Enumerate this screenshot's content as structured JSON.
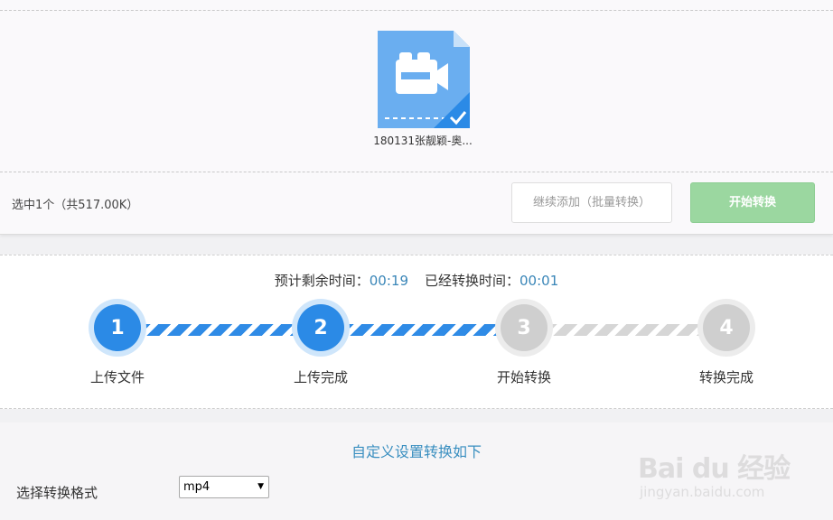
{
  "upload": {
    "file_name": "180131张靓颖-奥...",
    "selected_info": "选中1个（共517.00K）",
    "add_more_label": "继续添加（批量转换）",
    "start_label": "开始转换"
  },
  "progress": {
    "remaining_label": "预计剩余时间：",
    "remaining_value": "00:19",
    "elapsed_label": "已经转换时间：",
    "elapsed_value": "00:01",
    "steps": [
      {
        "number": "1",
        "label": "上传文件",
        "state": "done"
      },
      {
        "number": "2",
        "label": "上传完成",
        "state": "done"
      },
      {
        "number": "3",
        "label": "开始转换",
        "state": "pending"
      },
      {
        "number": "4",
        "label": "转换完成",
        "state": "pending"
      }
    ]
  },
  "settings": {
    "title": "自定义设置转换如下",
    "format_label": "选择转换格式",
    "format_value": "mp4"
  },
  "watermark": {
    "logo_text": "Bai du 经验",
    "url": "jingyan.baidu.com"
  },
  "colors": {
    "accent_blue": "#2b8ae6",
    "start_button": "#9bd7a0",
    "link_blue": "#3a86b8"
  }
}
